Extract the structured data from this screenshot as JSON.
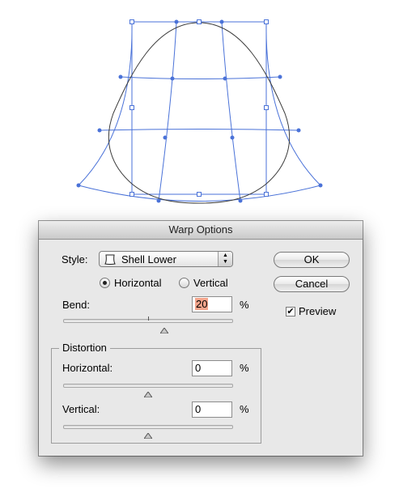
{
  "dialog": {
    "title": "Warp Options",
    "style_label": "Style:",
    "style_value": "Shell Lower",
    "style_icon": "shell-lower-icon",
    "orientation": {
      "horizontal_label": "Horizontal",
      "vertical_label": "Vertical",
      "selected": "Horizontal"
    },
    "bend": {
      "label": "Bend:",
      "value": "20",
      "unit": "%",
      "slider_value": 20
    },
    "distortion": {
      "title": "Distortion",
      "horizontal": {
        "label": "Horizontal:",
        "value": "0",
        "unit": "%",
        "slider_value": 0
      },
      "vertical": {
        "label": "Vertical:",
        "value": "0",
        "unit": "%",
        "slider_value": 0
      }
    },
    "ok_label": "OK",
    "cancel_label": "Cancel",
    "preview": {
      "label": "Preview",
      "checked": true
    }
  },
  "colors": {
    "mesh": "#4a72d8",
    "shape_outline": "#3a3a3a",
    "field_highlight": "#f4a58c"
  }
}
